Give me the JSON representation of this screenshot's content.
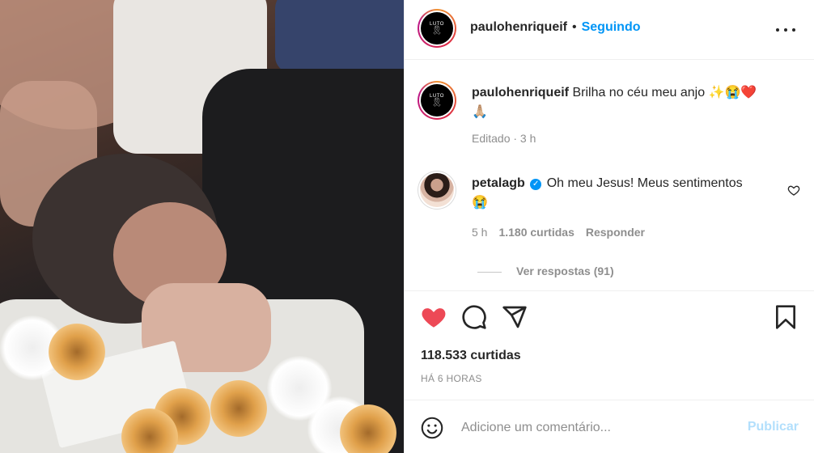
{
  "post": {
    "author": "paulohenriqueif",
    "follow_label": "Seguindo",
    "separator": "•",
    "avatar_text": "LUTO",
    "avatar_symbol": "🎗"
  },
  "caption": {
    "author": "paulohenriqueif",
    "text": "Brilha no céu meu anjo ✨😭❤️",
    "text_line2": "🙏🏼",
    "meta": "Editado · 3 h"
  },
  "comment": {
    "author": "petalagb",
    "verified_icon": "verified-badge-icon",
    "text": "Oh meu Jesus! Meus sentimentos",
    "text_line2": "😭",
    "time": "5 h",
    "likes": "1.180 curtidas",
    "reply": "Responder",
    "view_replies": "Ver respostas (91)"
  },
  "actions": {
    "likes": "118.533 curtidas",
    "time": "HÁ 6 HORAS",
    "like_icon": "heart-filled-icon",
    "comment_icon": "comment-icon",
    "share_icon": "share-icon",
    "save_icon": "bookmark-icon",
    "like_color": "#ed4956"
  },
  "composer": {
    "placeholder": "Adicione um comentário...",
    "publish": "Publicar"
  }
}
